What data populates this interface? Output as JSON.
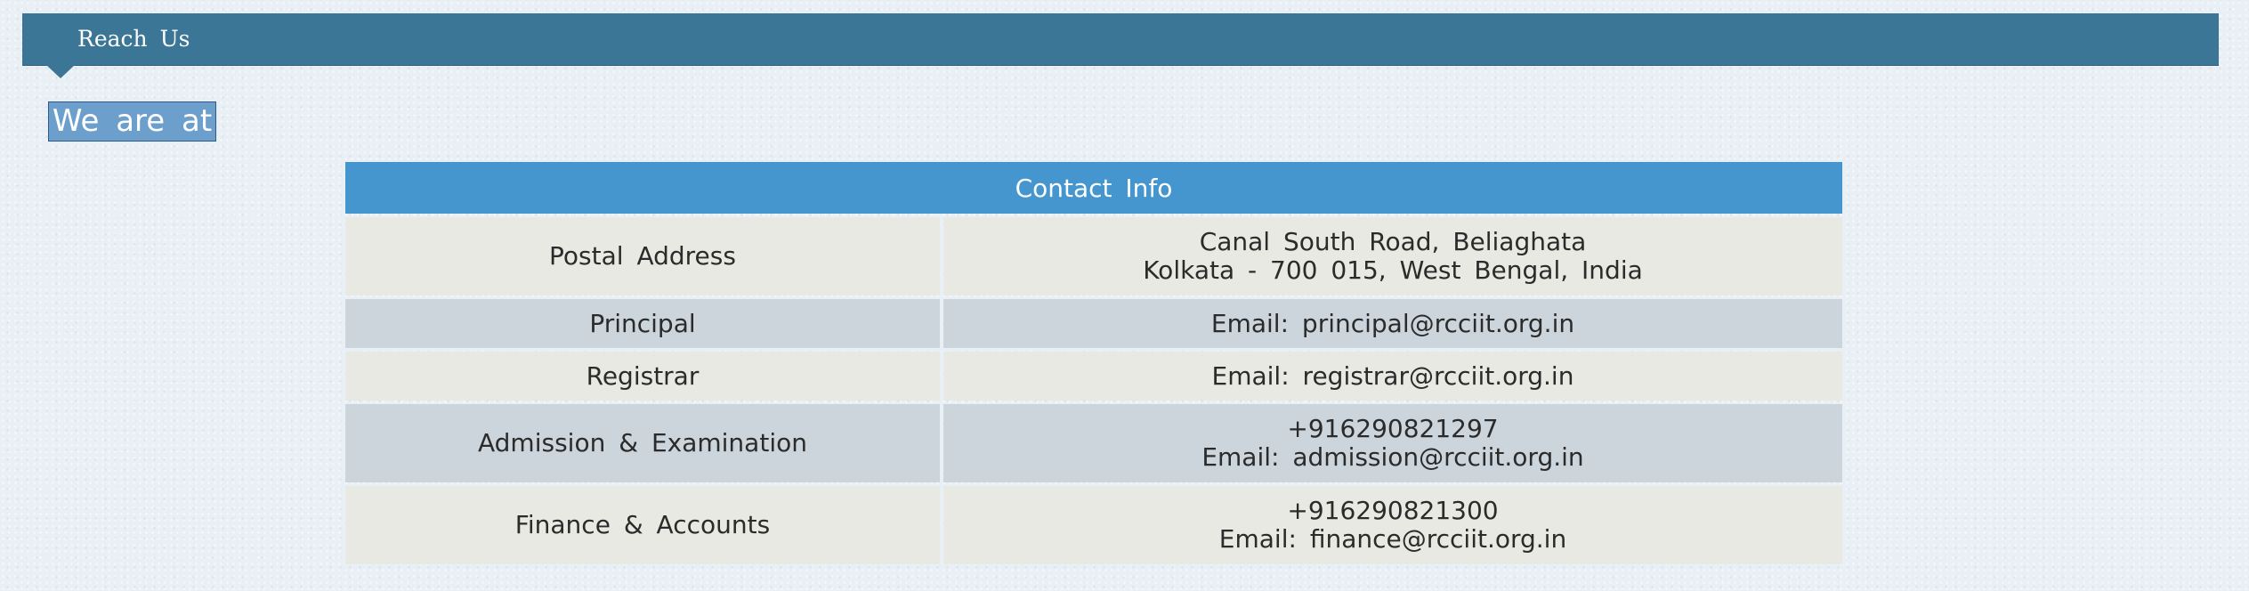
{
  "header": {
    "title": "Reach  Us"
  },
  "section": {
    "heading": "We  are  at"
  },
  "contact_table": {
    "title": "Contact  Info",
    "rows": [
      {
        "label": "Postal  Address",
        "lines": [
          "Canal  South  Road,  Beliaghata",
          "Kolkata  -  700  015,  West  Bengal,  India"
        ]
      },
      {
        "label": "Principal",
        "lines": [
          "Email:  principal@rcciit.org.in"
        ]
      },
      {
        "label": "Registrar",
        "lines": [
          "Email:  registrar@rcciit.org.in"
        ]
      },
      {
        "label": "Admission  &  Examination",
        "lines": [
          "+916290821297",
          "Email:  admission@rcciit.org.in"
        ]
      },
      {
        "label": "Finance  &  Accounts",
        "lines": [
          "+916290821300",
          "Email:  finance@rcciit.org.in"
        ]
      }
    ]
  },
  "colors": {
    "header_bar": "#3b7696",
    "table_header": "#4596cf",
    "row_light": "#e8e9e2",
    "row_dark": "#ccd5dc"
  }
}
